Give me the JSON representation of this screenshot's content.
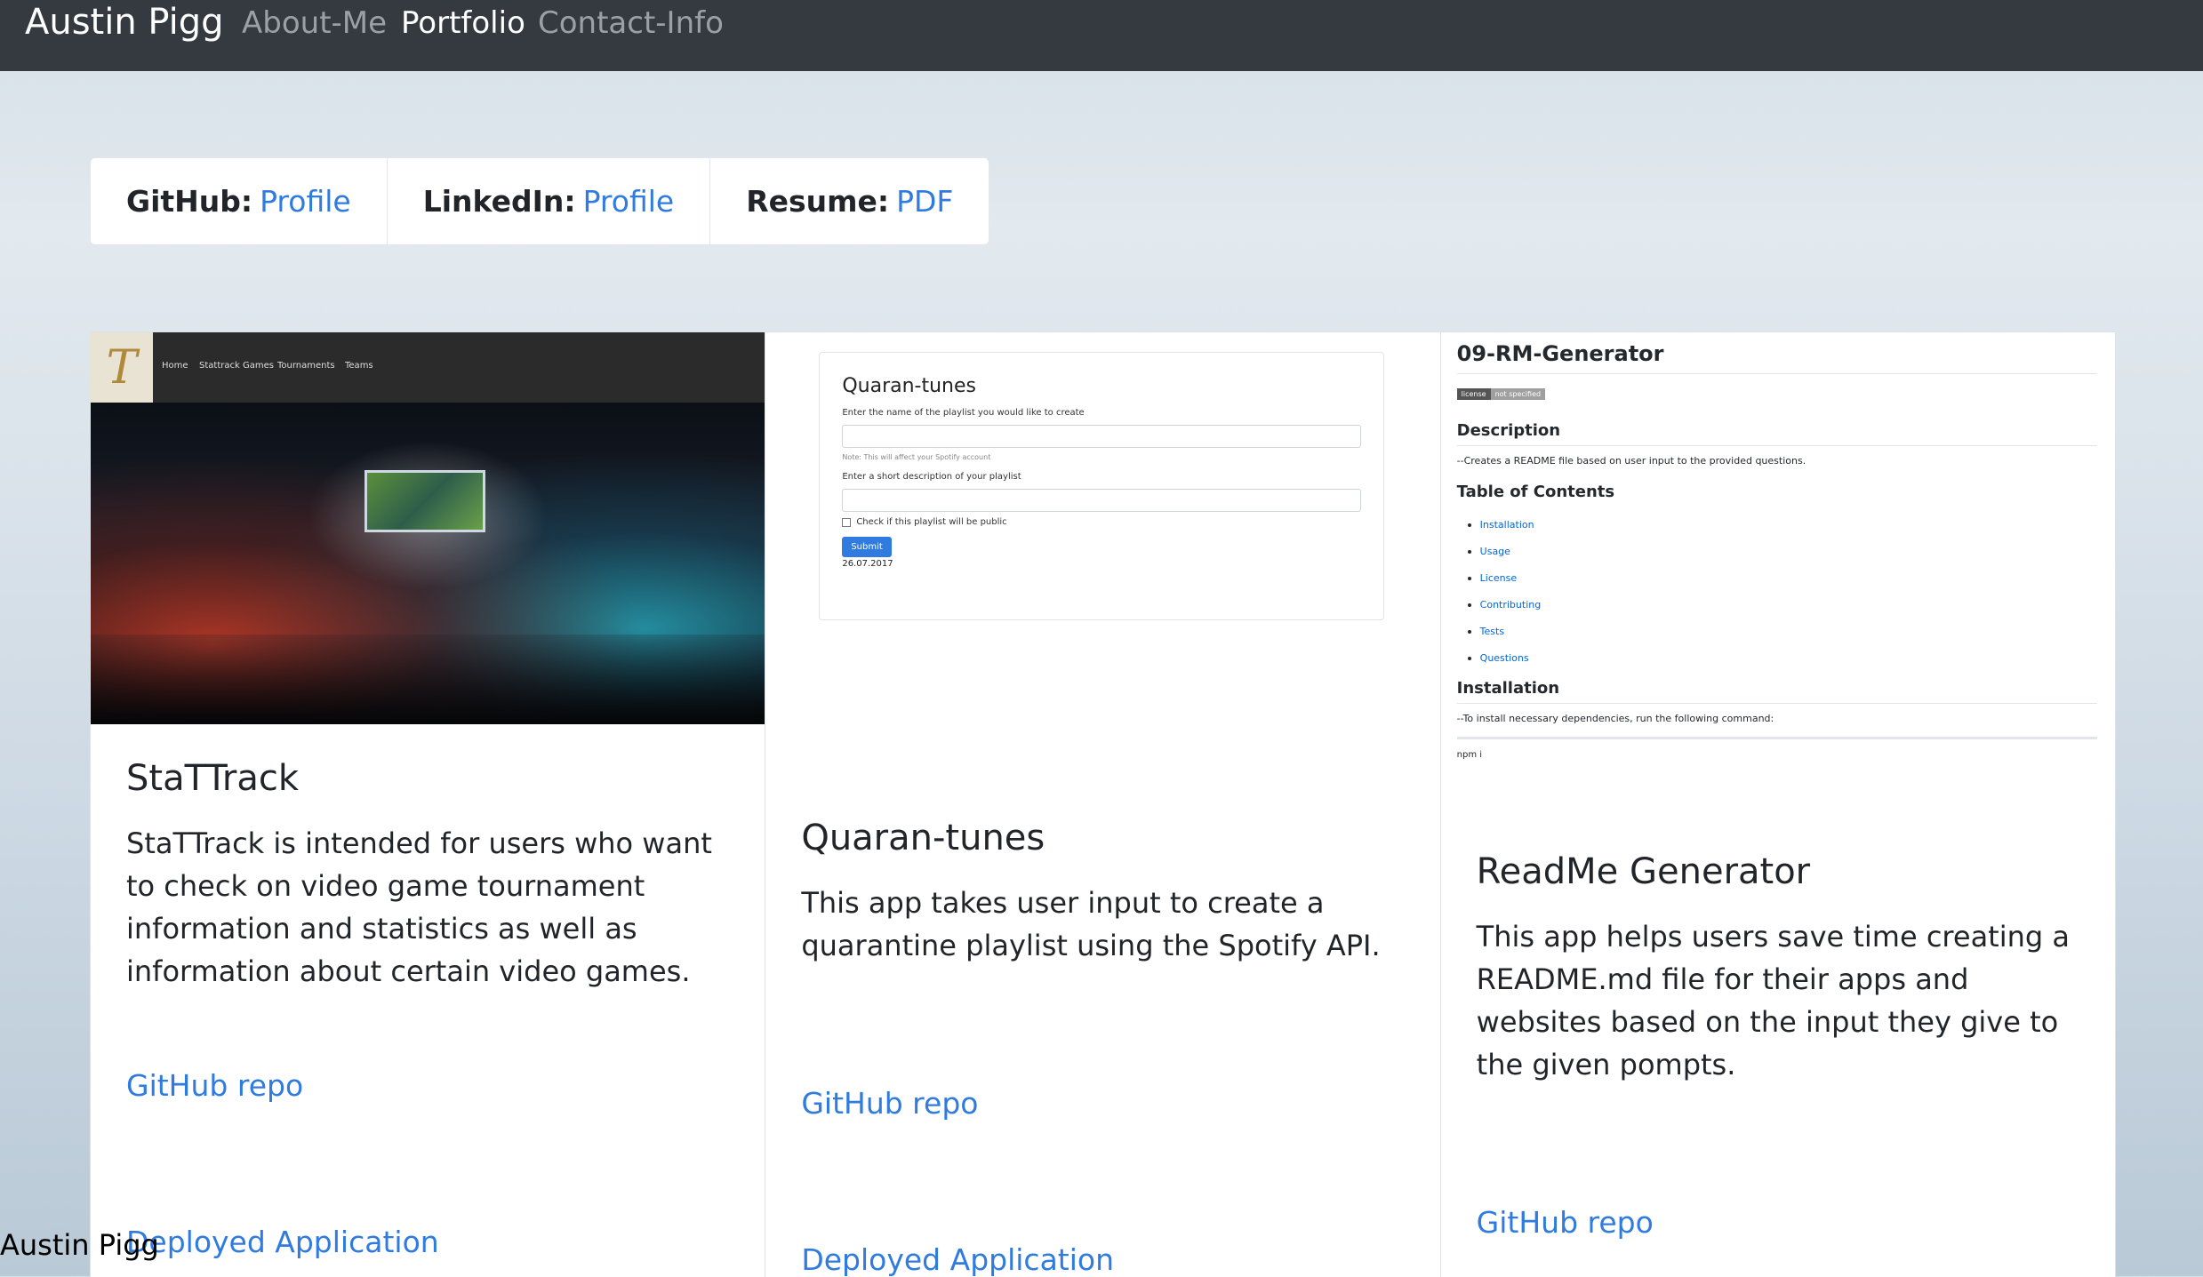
{
  "navbar": {
    "brand": "Austin Pigg",
    "links": [
      {
        "label": "About-Me",
        "active": false
      },
      {
        "label": "Portfolio",
        "active": true
      },
      {
        "label": "Contact-Info",
        "active": false
      }
    ]
  },
  "links_bar": [
    {
      "label": "GitHub:",
      "link": "Profile"
    },
    {
      "label": "LinkedIn:",
      "link": "Profile"
    },
    {
      "label": "Resume:",
      "link": "PDF"
    }
  ],
  "cards": [
    {
      "title": "StaTTrack",
      "text": "StaTTrack is intended for users who want to check on video game tournament information and statistics as well as information about certain video games.",
      "repo_link": "GitHub repo",
      "app_link": "Deployed Application",
      "image": {
        "logo_letter": "T",
        "nav": [
          "Home",
          "Stattrack Games",
          "Tournaments",
          "Teams"
        ]
      }
    },
    {
      "title": "Quaran-tunes",
      "text": "This app takes user input to create a quarantine playlist using the Spotify API.",
      "repo_link": "GitHub repo",
      "app_link": "Deployed Application",
      "image": {
        "title": "Quaran-tunes",
        "label_name": "Enter the name of the playlist you would like to create",
        "note": "Note: This will affect your Spotify account",
        "label_desc": "Enter a short description of your playlist",
        "checkbox": "Check if this playlist will be public",
        "submit": "Submit",
        "date": "26.07.2017"
      }
    },
    {
      "title": "ReadMe Generator",
      "text": "This app helps users save time creating a README.md file for their apps and websites based on the input they give to the given pompts.",
      "repo_link": "GitHub repo",
      "image": {
        "title": "09-RM-Generator",
        "badge_left": "license",
        "badge_right": "not specified",
        "desc_heading": "Description",
        "desc_text": "--Creates a README file based on user input to the provided questions.",
        "toc_heading": "Table of Contents",
        "toc": [
          "Installation",
          "Usage",
          "License",
          "Contributing",
          "Tests",
          "Questions"
        ],
        "install_heading": "Installation",
        "install_text": "--To install necessary dependencies, run the following command:",
        "code": "npm i"
      }
    }
  ],
  "footer": {
    "text": "Austin Pigg"
  },
  "colors": {
    "navbar": "#343a40",
    "link": "#2f7be0"
  }
}
